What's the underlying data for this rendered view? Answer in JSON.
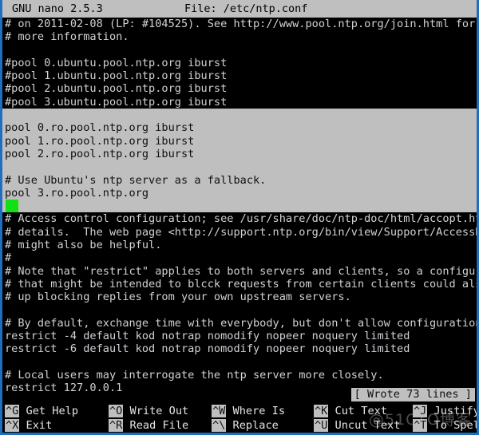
{
  "titlebar": {
    "app": "GNU nano 2.5.3",
    "file_label": "File: /etc/ntp.conf"
  },
  "editor": {
    "lines": [
      {
        "text": "# on 2011-02-08 (LP: #104525). See http://www.pool.ntp.org/join.html for",
        "selected": false
      },
      {
        "text": "# more information.",
        "selected": false
      },
      {
        "text": "",
        "selected": false
      },
      {
        "text": "#pool 0.ubuntu.pool.ntp.org iburst",
        "selected": false
      },
      {
        "text": "#pool 1.ubuntu.pool.ntp.org iburst",
        "selected": false
      },
      {
        "text": "#pool 2.ubuntu.pool.ntp.org iburst",
        "selected": false
      },
      {
        "text": "#pool 3.ubuntu.pool.ntp.org iburst",
        "selected": false
      },
      {
        "text": "",
        "selected": true
      },
      {
        "text": "pool 0.ro.pool.ntp.org iburst",
        "selected": true
      },
      {
        "text": "pool 1.ro.pool.ntp.org iburst",
        "selected": true
      },
      {
        "text": "pool 2.ro.pool.ntp.org iburst",
        "selected": true
      },
      {
        "text": "",
        "selected": true
      },
      {
        "text": "# Use Ubuntu's ntp server as a fallback.",
        "selected": true
      },
      {
        "text": "pool 3.ro.pool.ntp.org",
        "selected": true
      },
      {
        "text": "__CURSOR__",
        "selected": true
      },
      {
        "text": "# Access control configuration; see /usr/share/doc/ntp-doc/html/accopt.html",
        "selected": false
      },
      {
        "text": "# details.  The web page <http://support.ntp.org/bin/view/Support/AccessRest",
        "selected": false
      },
      {
        "text": "# might also be helpful.",
        "selected": false
      },
      {
        "text": "#",
        "selected": false
      },
      {
        "text": "# Note that \"restrict\" applies to both servers and clients, so a configurati",
        "selected": false
      },
      {
        "text": "# that might be intended to blcck requests from certain clients could also e",
        "selected": false
      },
      {
        "text": "# up blocking replies from your own upstream servers.",
        "selected": false
      },
      {
        "text": "",
        "selected": false
      },
      {
        "text": "# By default, exchange time with everybody, but don't allow configuration.",
        "selected": false
      },
      {
        "text": "restrict -4 default kod notrap nomodify nopeer noquery limited",
        "selected": false
      },
      {
        "text": "restrict -6 default kod notrap nomodify nopeer noquery limited",
        "selected": false
      },
      {
        "text": "",
        "selected": false
      },
      {
        "text": "# Local users may interrogate the ntp server more closely.",
        "selected": false
      },
      {
        "text": "restrict 127.0.0.1",
        "selected": false
      }
    ]
  },
  "status": {
    "message": "[ Wrote 73 lines ]"
  },
  "helpbar": {
    "columns": [
      {
        "top": {
          "key": "^G",
          "label": " Get Help"
        },
        "bottom": {
          "key": "^X",
          "label": " Exit"
        }
      },
      {
        "top": {
          "key": "^O",
          "label": " Write Out"
        },
        "bottom": {
          "key": "^R",
          "label": " Read File"
        }
      },
      {
        "top": {
          "key": "^W",
          "label": " Where Is"
        },
        "bottom": {
          "key": "^\\",
          "label": " Replace"
        }
      },
      {
        "top": {
          "key": "^K",
          "label": " Cut Text"
        },
        "bottom": {
          "key": "^U",
          "label": " Uncut Text"
        }
      },
      {
        "top": {
          "key": "^J",
          "label": " Justify"
        },
        "bottom": {
          "key": "^T",
          "label": " To Spell"
        }
      }
    ]
  },
  "watermark": {
    "text": "@51CTO博客"
  },
  "colors": {
    "background": "#000000",
    "foreground": "#cfd2d6",
    "inverse_bg": "#bfbfbf",
    "inverse_fg": "#101010",
    "cursor": "#13e013",
    "window_border": "#1f6fbf"
  }
}
